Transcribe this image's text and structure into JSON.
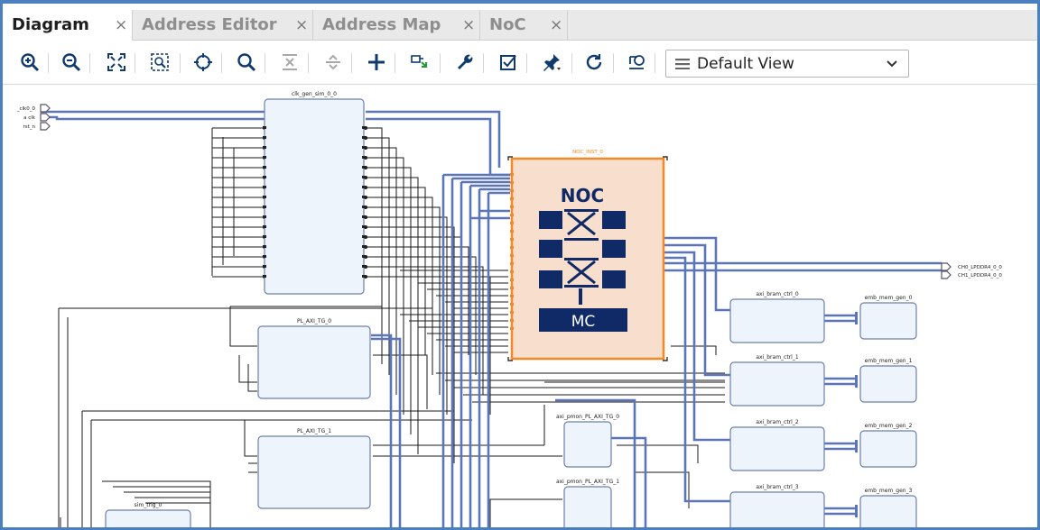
{
  "tabs": [
    {
      "label": "Diagram",
      "active": true
    },
    {
      "label": "Address Editor",
      "active": false
    },
    {
      "label": "Address Map",
      "active": false
    },
    {
      "label": "NoC",
      "active": false
    }
  ],
  "tab_close": "×",
  "toolbar": {
    "icons": [
      "zoom-in-icon",
      "zoom-out-icon",
      "fit-view-icon",
      "zoom-select-icon",
      "center-icon",
      "search-icon",
      "collapse-all-icon",
      "expand-all-icon",
      "add-ip-icon",
      "make-connection-icon",
      "settings-wrench-icon",
      "validate-icon",
      "pin-icon",
      "refresh-icon",
      "regenerate-layout-icon"
    ],
    "view_selector": "Default View"
  },
  "diagram": {
    "ports_left": [
      "_clk0_0",
      "a clk",
      "rst_n"
    ],
    "ports_right": [
      "CH0_LPDDR4_0_0",
      "CH1_LPDDR4_0_0"
    ],
    "blocks": {
      "clk_gen": "clk_gen_sim_0_0",
      "noc": "NOC_INST_0",
      "noc_title": "NOC",
      "noc_mc": "MC",
      "tg0": "PL_AXI_TG_0",
      "tg1": "PL_AXI_TG_1",
      "sim_trig": "sim_trig_0",
      "noc_pmon0": "axi_pmon_PL_AXI_TG_0",
      "noc_pmon1": "axi_pmon_PL_AXI_TG_1",
      "bram_ctrl": [
        "axi_bram_ctrl_0",
        "axi_bram_ctrl_1",
        "axi_bram_ctrl_2",
        "axi_bram_ctrl_3"
      ],
      "bram": [
        "emb_mem_gen_0",
        "emb_mem_gen_1",
        "emb_mem_gen_2",
        "emb_mem_gen_3"
      ]
    },
    "colors": {
      "bus": "#5a76b8",
      "wire": "#1a1a1a",
      "block_fill": "#eef4fc",
      "block_stroke": "#6d7fa8",
      "noc_fill": "#f8dfcd",
      "noc_stroke": "#f08a2a",
      "noc_label": "#f08a2a",
      "noc_icon": "#0f2a66",
      "accent": "#4a7fc0"
    }
  }
}
